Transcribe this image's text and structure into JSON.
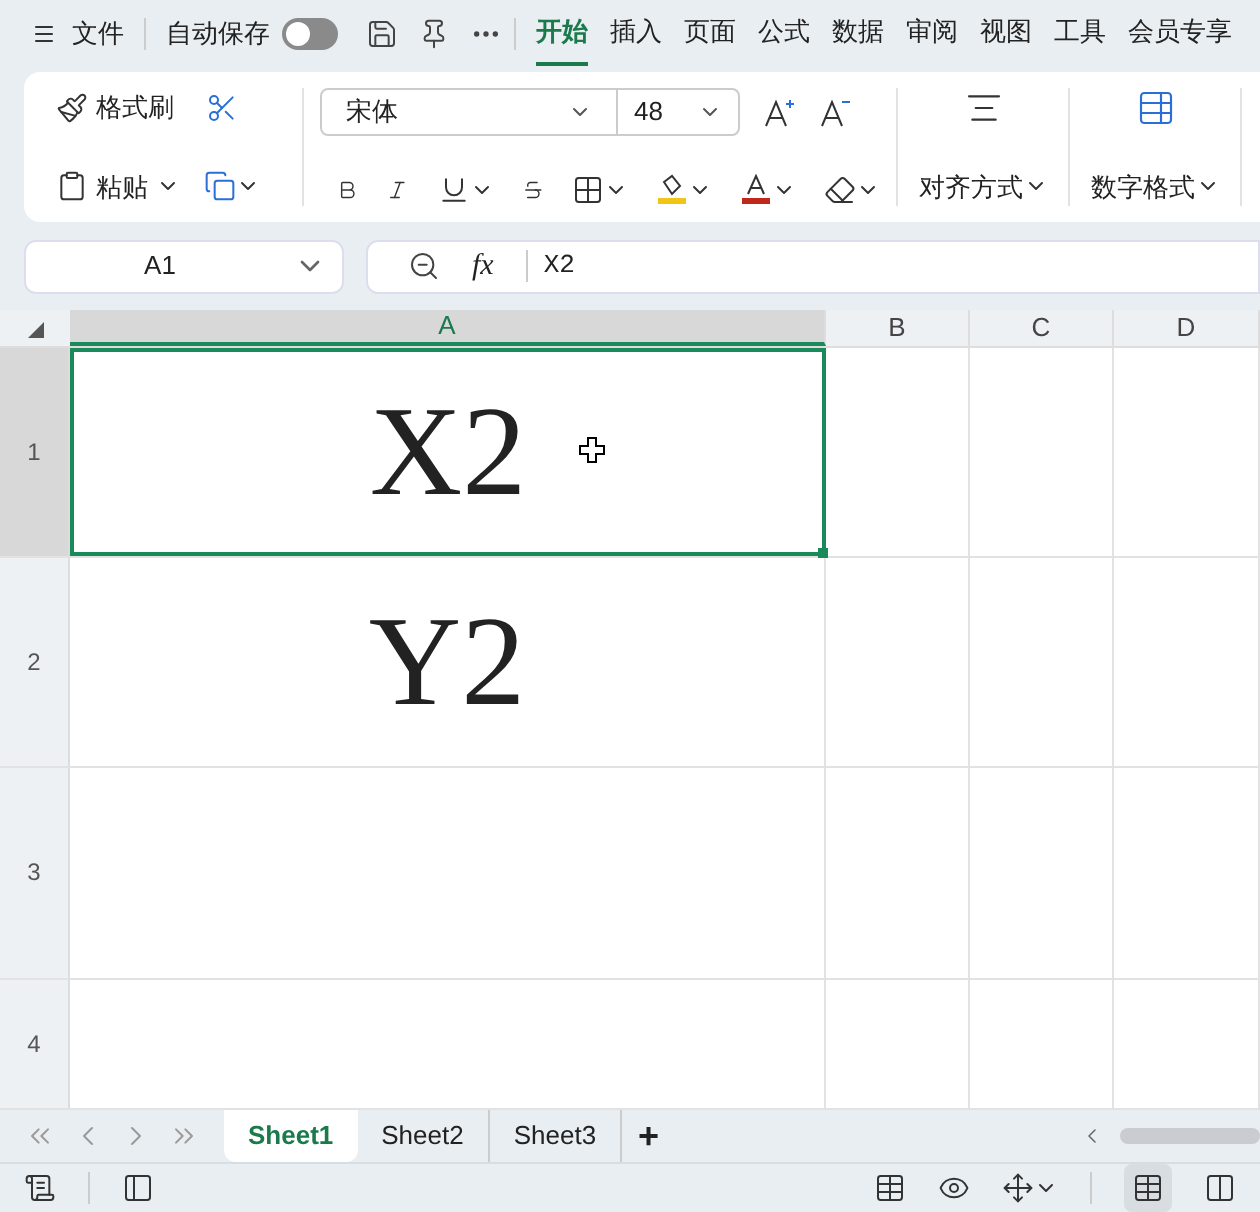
{
  "menu": {
    "label": "文件"
  },
  "autosave": {
    "label": "自动保存",
    "on": false
  },
  "tabs": [
    {
      "label": "开始",
      "selected": true
    },
    {
      "label": "插入",
      "selected": false
    },
    {
      "label": "页面",
      "selected": false
    },
    {
      "label": "公式",
      "selected": false
    },
    {
      "label": "数据",
      "selected": false
    },
    {
      "label": "审阅",
      "selected": false
    },
    {
      "label": "视图",
      "selected": false
    },
    {
      "label": "工具",
      "selected": false
    },
    {
      "label": "会员专享",
      "selected": false
    }
  ],
  "ribbon": {
    "format_painter": "格式刷",
    "paste": "粘贴",
    "font": "宋体",
    "font_size": "48",
    "align": "对齐方式",
    "number_format": "数字格式"
  },
  "name_box": "A1",
  "formula": {
    "fx": "fx",
    "value": "X2"
  },
  "columns": [
    {
      "label": "A",
      "selected": true
    },
    {
      "label": "B",
      "selected": false
    },
    {
      "label": "C",
      "selected": false
    },
    {
      "label": "D",
      "selected": false
    }
  ],
  "rows": [
    {
      "label": "1",
      "selected": true,
      "cell": "X2"
    },
    {
      "label": "2",
      "selected": false,
      "cell": "Y2"
    },
    {
      "label": "3",
      "selected": false
    },
    {
      "label": "4",
      "selected": false
    }
  ],
  "sheets": [
    {
      "label": "Sheet1",
      "selected": true
    },
    {
      "label": "Sheet2",
      "selected": false
    },
    {
      "label": "Sheet3",
      "selected": false
    }
  ],
  "add_sheet": "+"
}
